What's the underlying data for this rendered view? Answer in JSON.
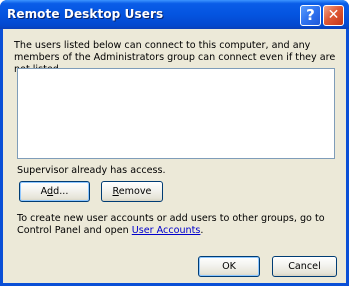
{
  "window": {
    "title": "Remote Desktop Users",
    "help_glyph": "?",
    "close_glyph": "✕"
  },
  "main": {
    "description": "The users listed below can connect to this computer, and any members of the Administrators group can connect even if they are not listed.",
    "status": "Supervisor already has access.",
    "info_prefix": "To create new user accounts or add users to other groups, go to Control Panel and open ",
    "info_link": "User Accounts",
    "info_suffix": "."
  },
  "buttons": {
    "add_a": "A",
    "add_d": "d",
    "add_rest": "d...",
    "remove": "Remove",
    "ok": "OK",
    "cancel": "Cancel"
  }
}
